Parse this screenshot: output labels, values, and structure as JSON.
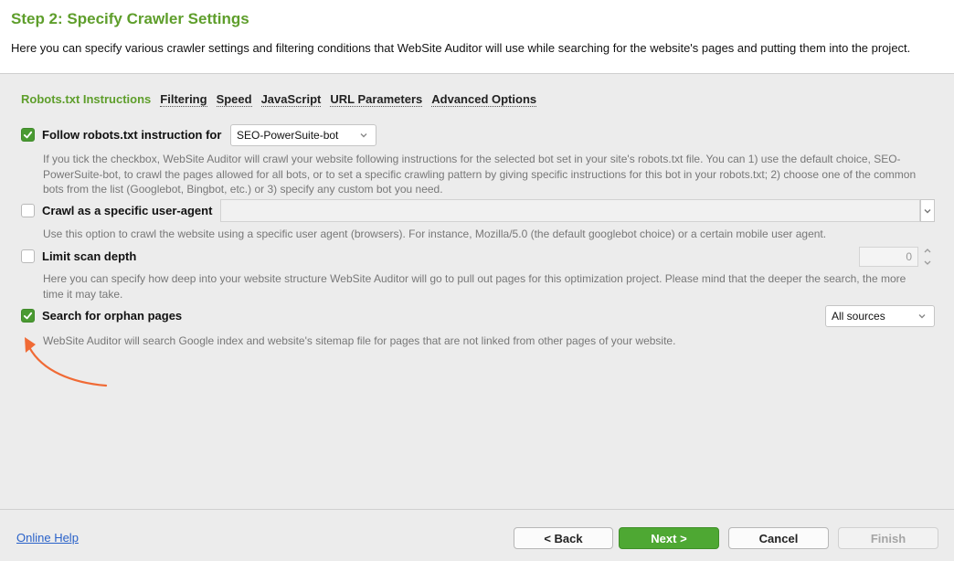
{
  "header": {
    "title": "Step 2: Specify Crawler Settings",
    "description": "Here you can specify various crawler settings and filtering conditions that WebSite Auditor will use while searching for the website's pages and putting them into the project."
  },
  "tabs": [
    {
      "label": "Robots.txt Instructions",
      "active": true
    },
    {
      "label": "Filtering"
    },
    {
      "label": "Speed"
    },
    {
      "label": "JavaScript"
    },
    {
      "label": "URL Parameters"
    },
    {
      "label": "Advanced Options"
    }
  ],
  "options": {
    "robots": {
      "checked": true,
      "label": "Follow robots.txt instruction for",
      "select_value": "SEO-PowerSuite-bot",
      "help": "If you tick the checkbox, WebSite Auditor will crawl your website following instructions for the selected bot set in your site's robots.txt file. You can 1) use the default choice, SEO-PowerSuite-bot, to crawl the pages allowed for all bots, or to set a specific crawling pattern by giving specific instructions for this bot in your robots.txt; 2) choose one of the common bots from the list (Googlebot, Bingbot, etc.) or 3) specify any custom bot you need."
    },
    "user_agent": {
      "checked": false,
      "label": "Crawl as a specific user-agent",
      "value": "",
      "help": "Use this option to crawl the website using a specific user agent (browsers). For instance, Mozilla/5.0 (the default googlebot choice) or a certain mobile user agent."
    },
    "depth": {
      "checked": false,
      "label": "Limit scan depth",
      "value": "0",
      "help": "Here you can specify how deep into your website structure WebSite Auditor will go to pull out pages for this optimization project. Please mind that the deeper the search, the more time it may take."
    },
    "orphan": {
      "checked": true,
      "label": "Search for orphan pages",
      "select_value": "All sources",
      "help": "WebSite Auditor will search Google index and website's sitemap file for pages that are not linked from other pages of your website."
    }
  },
  "footer": {
    "help_link": "Online Help",
    "back": "< Back",
    "next": "Next >",
    "cancel": "Cancel",
    "finish": "Finish"
  },
  "colors": {
    "accent_green": "#5e9e2b",
    "checkbox_green": "#4a9a32",
    "arrow_orange": "#f06a35",
    "link_blue": "#2a62c9"
  }
}
